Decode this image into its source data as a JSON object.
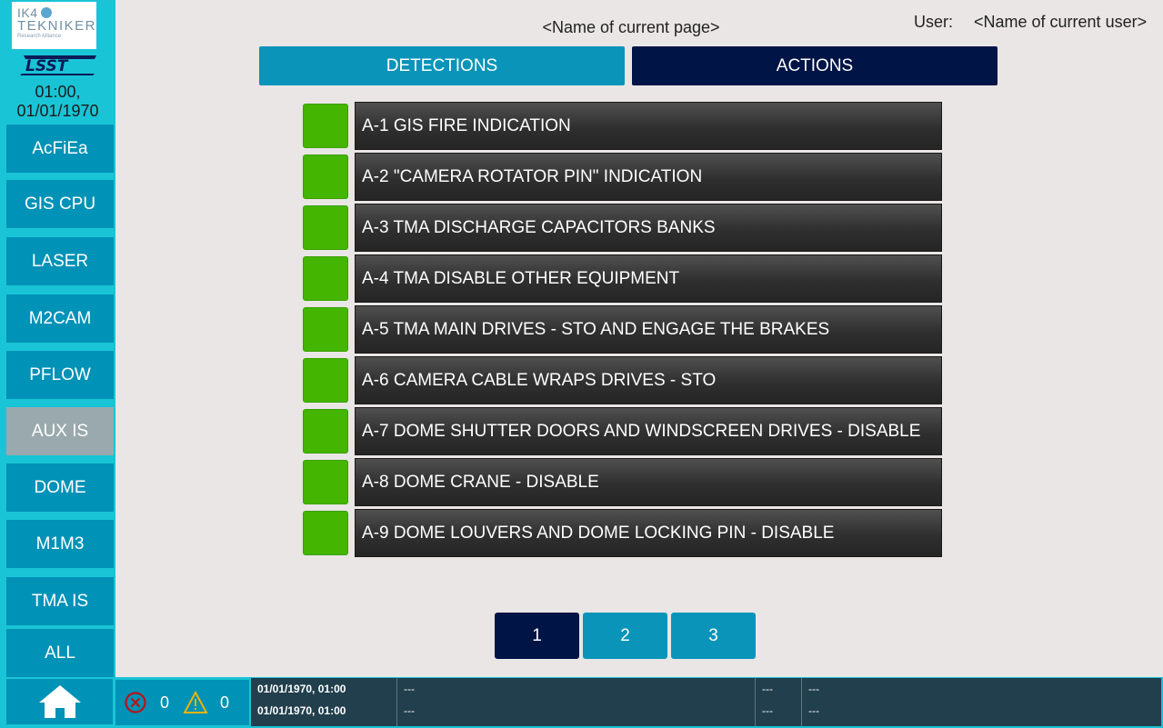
{
  "header": {
    "page_title": "<Name of current page>",
    "user_label": "User:",
    "user_name": "<Name of current user>"
  },
  "sidebar": {
    "logo_ik4_line1": "IK4",
    "logo_ik4_line2": "TEKNIKER",
    "logo_ik4_line3": "Research Alliance",
    "logo_lsst": "LSST",
    "clock_time": "01:00,",
    "clock_date": "01/01/1970",
    "items": [
      {
        "label": "AcFiEa"
      },
      {
        "label": "GIS CPU"
      },
      {
        "label": "LASER"
      },
      {
        "label": "M2CAM"
      },
      {
        "label": "PFLOW"
      },
      {
        "label": "AUX IS"
      },
      {
        "label": "DOME"
      },
      {
        "label": "M1M3"
      },
      {
        "label": "TMA IS"
      },
      {
        "label": "ALL"
      }
    ],
    "active_item": "AUX IS"
  },
  "tabs": {
    "detections": "DETECTIONS",
    "actions": "ACTIONS",
    "active": "ACTIONS"
  },
  "actions": [
    {
      "label": "A-1 GIS FIRE INDICATION",
      "status": "green"
    },
    {
      "label": "A-2 \"CAMERA ROTATOR PIN\" INDICATION",
      "status": "green"
    },
    {
      "label": "A-3 TMA DISCHARGE CAPACITORS BANKS",
      "status": "green"
    },
    {
      "label": "A-4 TMA DISABLE OTHER EQUIPMENT",
      "status": "green"
    },
    {
      "label": "A-5 TMA MAIN DRIVES - STO AND ENGAGE THE BRAKES",
      "status": "green"
    },
    {
      "label": "A-6 CAMERA CABLE WRAPS DRIVES - STO",
      "status": "green"
    },
    {
      "label": "A-7 DOME SHUTTER DOORS AND WINDSCREEN DRIVES - DISABLE",
      "status": "green"
    },
    {
      "label": "A-8 DOME CRANE - DISABLE",
      "status": "green"
    },
    {
      "label": "A-9 DOME LOUVERS AND DOME LOCKING PIN - DISABLE",
      "status": "green"
    }
  ],
  "pagination": {
    "pages": [
      "1",
      "2",
      "3"
    ],
    "current": "1"
  },
  "statusbar": {
    "error_count": "0",
    "warning_count": "0",
    "log": [
      {
        "timestamp": "01/01/1970, 01:00",
        "message": "---",
        "code": "---",
        "extra": "---"
      },
      {
        "timestamp": "01/01/1970, 01:00",
        "message": "---",
        "code": "---",
        "extra": "---"
      }
    ]
  },
  "colors": {
    "sidebar_bg": "#19c4d6",
    "button_blue": "#0092b7",
    "active_dark": "#001446",
    "status_green": "#44b500",
    "disabled_gray": "#9aa9ad"
  }
}
